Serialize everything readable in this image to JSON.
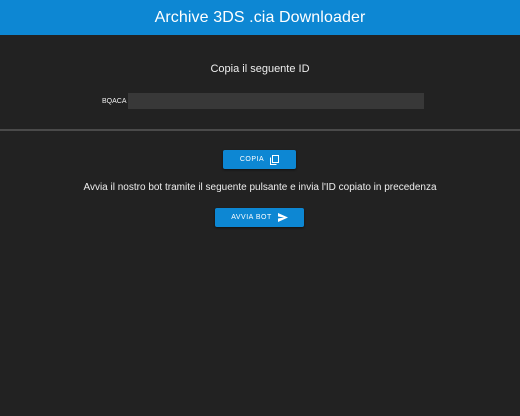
{
  "header": {
    "title": "Archive 3DS .cia Downloader"
  },
  "copy_section": {
    "title": "Copia il seguente ID",
    "id_prefix": "BQACA",
    "copy_button_label": "COPIA",
    "copy_icon": "copy-icon"
  },
  "bot_section": {
    "instructions": "Avvia il nostro bot tramite il seguente pulsante e invia l'ID copiato in precedenza",
    "bot_button_label": "AVVIA BOT",
    "send_icon": "send-icon"
  },
  "colors": {
    "accent": "#0d87d3",
    "background": "#222222",
    "redacted_field": "#383838",
    "divider": "#4a4a4a"
  }
}
